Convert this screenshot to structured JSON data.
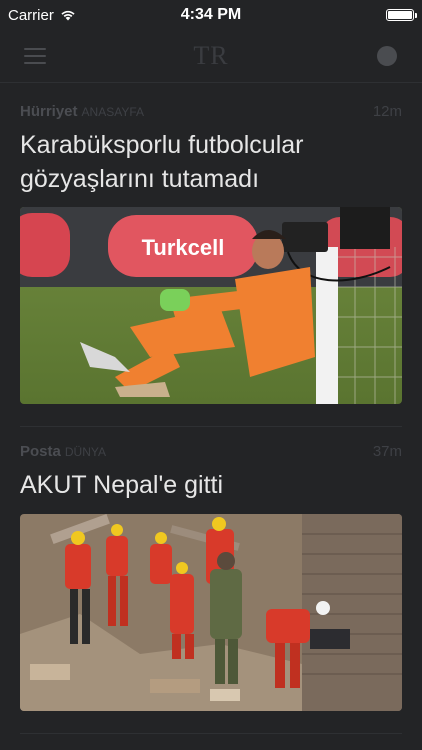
{
  "status": {
    "carrier": "Carrier",
    "time": "4:34 PM"
  },
  "nav": {
    "logo": "TR",
    "menu_icon": "hamburger-menu-icon",
    "profile_icon": "profile-dot-icon"
  },
  "articles": [
    {
      "source": "Hürriyet",
      "section": "ANASAYFA",
      "age": "12m",
      "headline": "Karabüksporlu futbolcular gözyaşlarını tutamadı",
      "image_desc": "goalkeeper-sitting-on-pitch",
      "ad_board_text": "Turkcell"
    },
    {
      "source": "Posta",
      "section": "DÜNYA",
      "age": "37m",
      "headline": "AKUT Nepal'e gitti",
      "image_desc": "rescue-workers-in-rubble"
    }
  ],
  "colors": {
    "background": "#232426",
    "headline": "#e6e6e6",
    "meta": "#4b4d52"
  }
}
